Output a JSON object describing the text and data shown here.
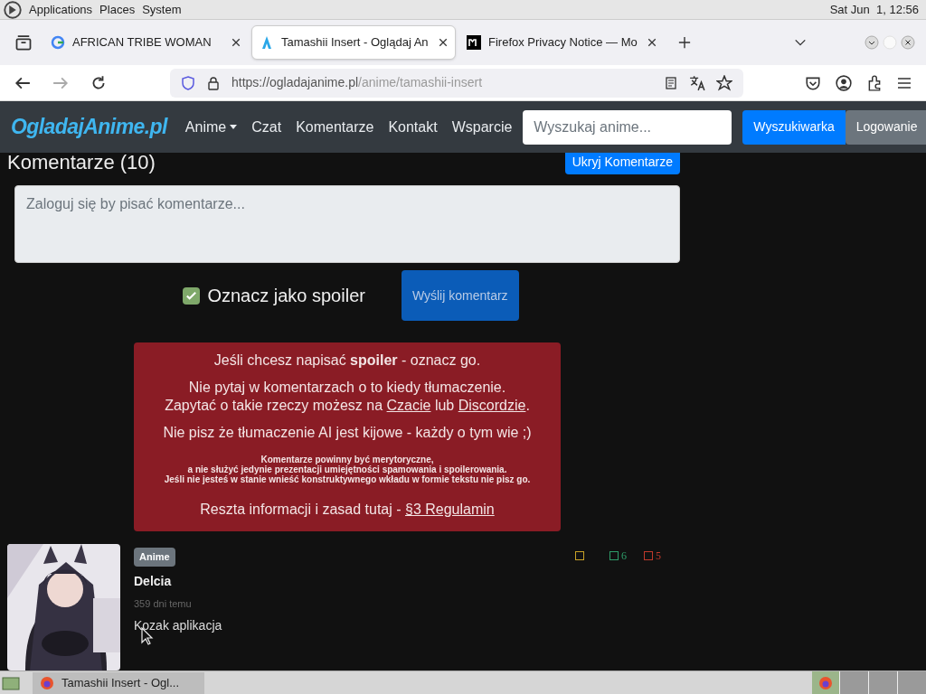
{
  "desktop_bar": {
    "menus": [
      "Applications",
      "Places",
      "System"
    ],
    "clock": "Sat Jun  1, 12:56"
  },
  "browser": {
    "tabs": [
      {
        "title": "AFRICAN TRIBE WOMAN",
        "kind": "google",
        "selected": false
      },
      {
        "title": "Tamashii Insert - Oglądaj An",
        "kind": "site",
        "selected": true
      },
      {
        "title": "Firefox Privacy Notice — Mo",
        "kind": "mozilla",
        "selected": false
      }
    ],
    "url_host": "https://ogladajanime.pl",
    "url_path": "/anime/tamashii-insert"
  },
  "navbar": {
    "logo": "OgladajAnime.pl",
    "links": [
      {
        "label": "Anime",
        "dropdown": true
      },
      {
        "label": "Czat",
        "dropdown": false
      },
      {
        "label": "Komentarze",
        "dropdown": false
      },
      {
        "label": "Kontakt",
        "dropdown": false
      },
      {
        "label": "Wsparcie",
        "dropdown": false
      }
    ],
    "search_placeholder": "Wyszukaj anime...",
    "search_button": "Wyszukiwarka",
    "login_button": "Logowanie"
  },
  "comments": {
    "heading": "Komentarze (10)",
    "hide_button": "Ukryj Komentarze",
    "textarea_placeholder": "Zaloguj się by pisać komentarze...",
    "spoiler_label": "Oznacz jako spoiler",
    "spoiler_checked": true,
    "submit_button": "Wyślij komentarz",
    "notice": {
      "line_1": "Jeśli chcesz napisać **spoiler** - oznacz go.",
      "line_2": "Nie pytaj w komentarzach o to kiedy tłumaczenie.",
      "line_3_before": "Zapytać o takie rzeczy możesz na",
      "link_chat": "Czacie",
      "line_3_middle": "lub",
      "link_discord": "Discordzie",
      "line_3_end": ".",
      "line_4": "Nie pisz że tłumaczenie AI jest kijowe - każdy o tym wie ;)",
      "small_lines": [
        "Komentarze powinny być merytoryczne,",
        "a nie służyć jedynie prezentacji umiejętności spamowania i spoilerowania.",
        "Jeśli nie jesteś w stanie wnieść konstruktywnego wkładu w formie tekstu nie pisz go."
      ],
      "rules_before": "Reszta informacji i zasad tutaj -",
      "rules_link": "§3 Regulamin"
    },
    "items": [
      {
        "badge": "Anime",
        "author": "Delcia",
        "time": "359 dni temu",
        "text": "Kozak aplikacja",
        "reactions": [
          {
            "color": "#c9a227"
          },
          {
            "count": "6",
            "color": "#2e9e6a"
          },
          {
            "count": "5",
            "color": "#c0392b"
          }
        ]
      }
    ]
  },
  "taskbar": {
    "window": "Tamashii Insert - Ogl..."
  }
}
